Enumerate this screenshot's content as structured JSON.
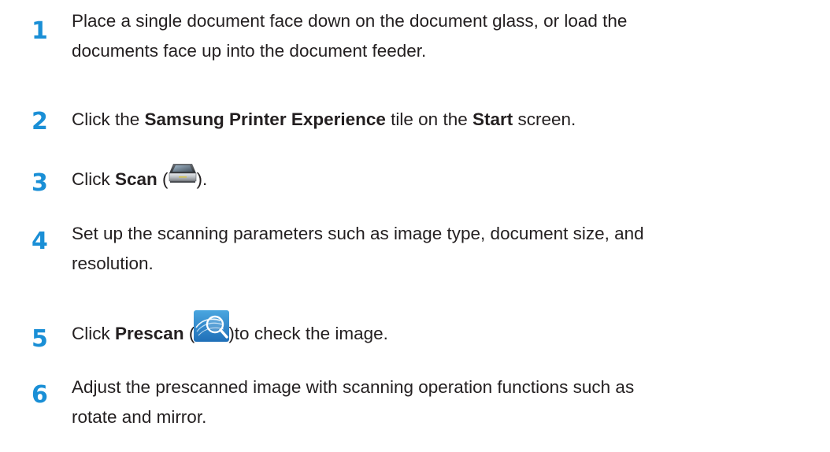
{
  "steps": [
    {
      "number": "1",
      "line1": "Place a single document face down on the document glass, or load the",
      "line2": "documents face up into the document feeder."
    },
    {
      "number": "2",
      "before": "Click the ",
      "bold1": "Samsung Printer Experience",
      "middle": " tile on the ",
      "bold2": "Start",
      "after": " screen."
    },
    {
      "number": "3",
      "before": "Click ",
      "bold": "Scan",
      "open": " (",
      "close": ")."
    },
    {
      "number": "4",
      "line1": "Set up the scanning parameters such as image type, document size, and",
      "line2": "resolution."
    },
    {
      "number": "5",
      "before": "Click ",
      "bold": "Prescan",
      "open": " (",
      "close": ")to check the image."
    },
    {
      "number": "6",
      "line1": "Adjust the prescanned image with scanning operation functions such as",
      "line2": "rotate and mirror."
    }
  ],
  "icons": {
    "scan": "scanner-icon",
    "prescan": "prescan-magnifier-icon"
  },
  "colors": {
    "step_number": "#1a8fd6",
    "body_text": "#231f20"
  }
}
